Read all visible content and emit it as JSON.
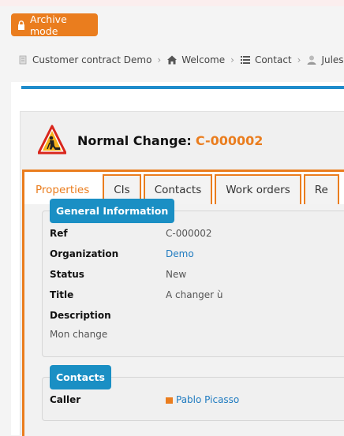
{
  "archive_button": {
    "label": "Archive mode"
  },
  "breadcrumb": [
    {
      "label": "Customer contract Demo",
      "icon": "document-icon"
    },
    {
      "label": "Welcome",
      "icon": "home-icon"
    },
    {
      "label": "Contact",
      "icon": "list-icon"
    },
    {
      "label": "Jules V",
      "icon": "user-icon"
    }
  ],
  "object": {
    "title": "Normal Change:",
    "ref": "C-000002",
    "icon": "warning-construction-icon"
  },
  "tabs": [
    {
      "label": "Properties",
      "active": true
    },
    {
      "label": "CIs"
    },
    {
      "label": "Contacts"
    },
    {
      "label": "Work orders"
    },
    {
      "label": "Re"
    }
  ],
  "general": {
    "legend": "General Information",
    "ref_label": "Ref",
    "ref_value": "C-000002",
    "org_label": "Organization",
    "org_value": "Demo",
    "status_label": "Status",
    "status_value": "New",
    "title_label": "Title",
    "title_value": "A changer ù",
    "description_label": "Description",
    "description_value": "Mon change"
  },
  "contacts": {
    "legend": "Contacts",
    "caller_label": "Caller",
    "caller_value": "Pablo Picasso"
  },
  "colors": {
    "accent": "#ea7d1e",
    "brand_blue": "#1a8fc4"
  }
}
